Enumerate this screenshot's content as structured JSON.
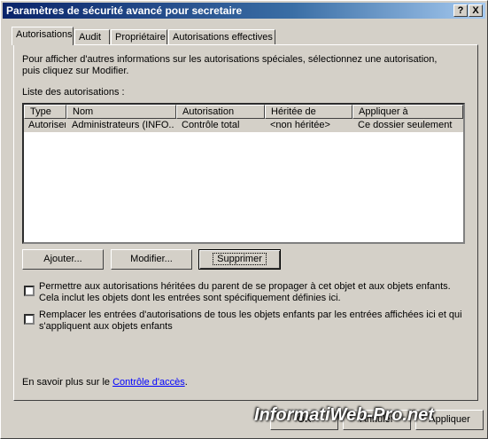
{
  "window": {
    "title": "Paramètres de sécurité avancé pour secretaire",
    "help_btn": "?",
    "close_btn": "X"
  },
  "tabs": [
    {
      "label": "Autorisations"
    },
    {
      "label": "Audit"
    },
    {
      "label": "Propriétaire"
    },
    {
      "label": "Autorisations effectives"
    }
  ],
  "info_text": "Pour afficher d'autres informations sur les autorisations spéciales, sélectionnez une autorisation, puis cliquez sur Modifier.",
  "list_label": "Liste des autorisations :",
  "columns": [
    "Type",
    "Nom",
    "Autorisation",
    "Héritée de",
    "Appliquer à"
  ],
  "rows": [
    {
      "type": "Autoriser",
      "name": "Administrateurs (INFO...",
      "permission": "Contrôle total",
      "inherited": "<non héritée>",
      "apply": "Ce dossier seulement"
    }
  ],
  "buttons": {
    "add": "Ajouter...",
    "edit": "Modifier...",
    "remove": "Supprimer"
  },
  "checkbox1": "Permettre aux autorisations héritées du parent de se propager à cet objet et aux objets enfants. Cela inclut les objets dont les entrées sont spécifiquement définies ici.",
  "checkbox2": "Remplacer les entrées d'autorisations de tous les objets enfants par les entrées affichées ici et qui s'appliquent aux objets enfants",
  "learn_more_prefix": "En savoir plus sur le",
  "learn_more_link": "Contrôle d'accès",
  "learn_more_suffix": ".",
  "footer": {
    "ok": "OK",
    "cancel": "Annuler",
    "apply": "Appliquer"
  },
  "watermark": "InformatiWeb-Pro.net"
}
